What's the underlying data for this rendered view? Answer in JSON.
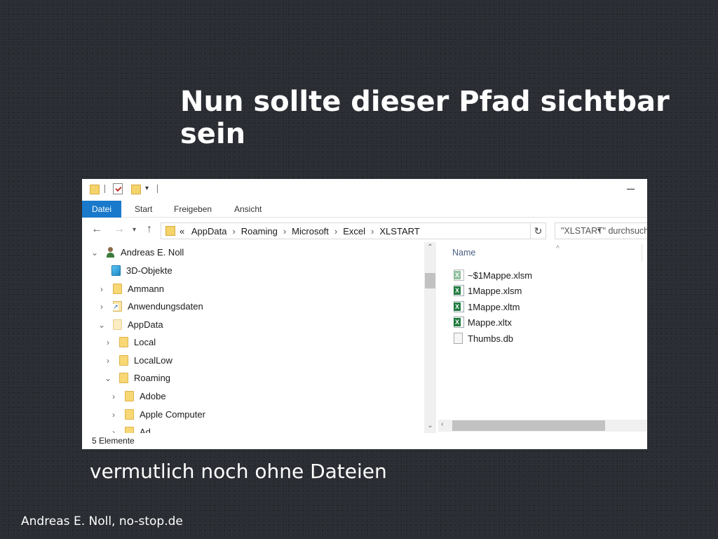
{
  "slide": {
    "title": "Nun sollte dieser Pfad sichtbar sein",
    "subtitle": "vermutlich noch ohne Dateien",
    "footer": "Andreas E. Noll, no-stop.de"
  },
  "explorer": {
    "ribbon_tabs": [
      "Datei",
      "Start",
      "Freigeben",
      "Ansicht"
    ],
    "address": {
      "overflow": "«",
      "crumbs": [
        "AppData",
        "Roaming",
        "Microsoft",
        "Excel",
        "XLSTART"
      ]
    },
    "search_placeholder": "\"XLSTART\" durchsuchen",
    "tree": [
      {
        "label": "Andreas E. Noll",
        "icon": "user-icon",
        "chevron": "expanded"
      },
      {
        "label": "3D-Objekte",
        "icon": "3d-objects-icon",
        "chevron": "none"
      },
      {
        "label": "Ammann",
        "icon": "folder-icon",
        "chevron": "collapsed"
      },
      {
        "label": "Anwendungsdaten",
        "icon": "shortcut-folder-icon",
        "chevron": "collapsed"
      },
      {
        "label": "AppData",
        "icon": "folder-icon",
        "chevron": "expanded"
      },
      {
        "label": "Local",
        "icon": "folder-icon",
        "chevron": "collapsed"
      },
      {
        "label": "LocalLow",
        "icon": "folder-icon",
        "chevron": "collapsed"
      },
      {
        "label": "Roaming",
        "icon": "folder-icon",
        "chevron": "expanded"
      },
      {
        "label": "Adobe",
        "icon": "folder-icon",
        "chevron": "collapsed"
      },
      {
        "label": "Apple Computer",
        "icon": "folder-icon",
        "chevron": "collapsed"
      },
      {
        "label": "Ad...",
        "icon": "folder-icon",
        "chevron": "collapsed"
      }
    ],
    "column_header": "Name",
    "files": [
      {
        "name": "~$1Mappe.xlsm",
        "icon": "excel-temp-icon"
      },
      {
        "name": "1Mappe.xlsm",
        "icon": "excel-icon"
      },
      {
        "name": "1Mappe.xltm",
        "icon": "excel-icon"
      },
      {
        "name": "Mappe.xltx",
        "icon": "excel-icon"
      },
      {
        "name": "Thumbs.db",
        "icon": "db-file-icon"
      }
    ],
    "status": "5 Elemente",
    "colors": {
      "accent": "#1979ca",
      "folder": "#f8d775",
      "excel": "#1e7b3e"
    }
  }
}
